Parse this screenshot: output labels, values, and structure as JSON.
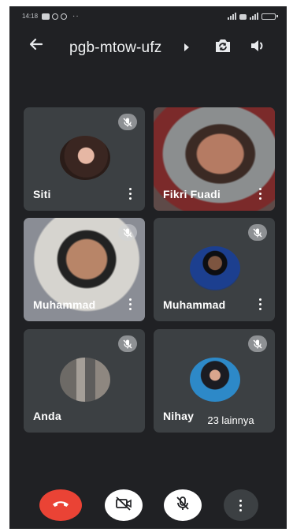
{
  "status_bar": {
    "time": "14:18",
    "dots": "··"
  },
  "meeting": {
    "code": "pgb-mtow-ufz"
  },
  "participants": [
    {
      "name": "Siti",
      "muted": true,
      "camera_on": false
    },
    {
      "name": "Fikri Fuadi",
      "muted": false,
      "camera_on": true
    },
    {
      "name": "Muhammad",
      "muted": true,
      "camera_on": true
    },
    {
      "name": "Muhammad",
      "muted": true,
      "camera_on": false
    },
    {
      "name": "Anda",
      "muted": true,
      "camera_on": false
    },
    {
      "name": "Nihay",
      "muted": true,
      "camera_on": false
    }
  ],
  "others_badge": "23 lainnya",
  "icons": {
    "back": "arrow-left-icon",
    "switch_camera": "switch-camera-icon",
    "speaker": "speaker-icon",
    "mute": "mic-off-icon",
    "more": "more-vert-icon",
    "end_call": "phone-end-icon",
    "video_off": "video-off-icon"
  },
  "colors": {
    "background": "#202124",
    "tile": "#3c4043",
    "end_call": "#ea4335"
  }
}
